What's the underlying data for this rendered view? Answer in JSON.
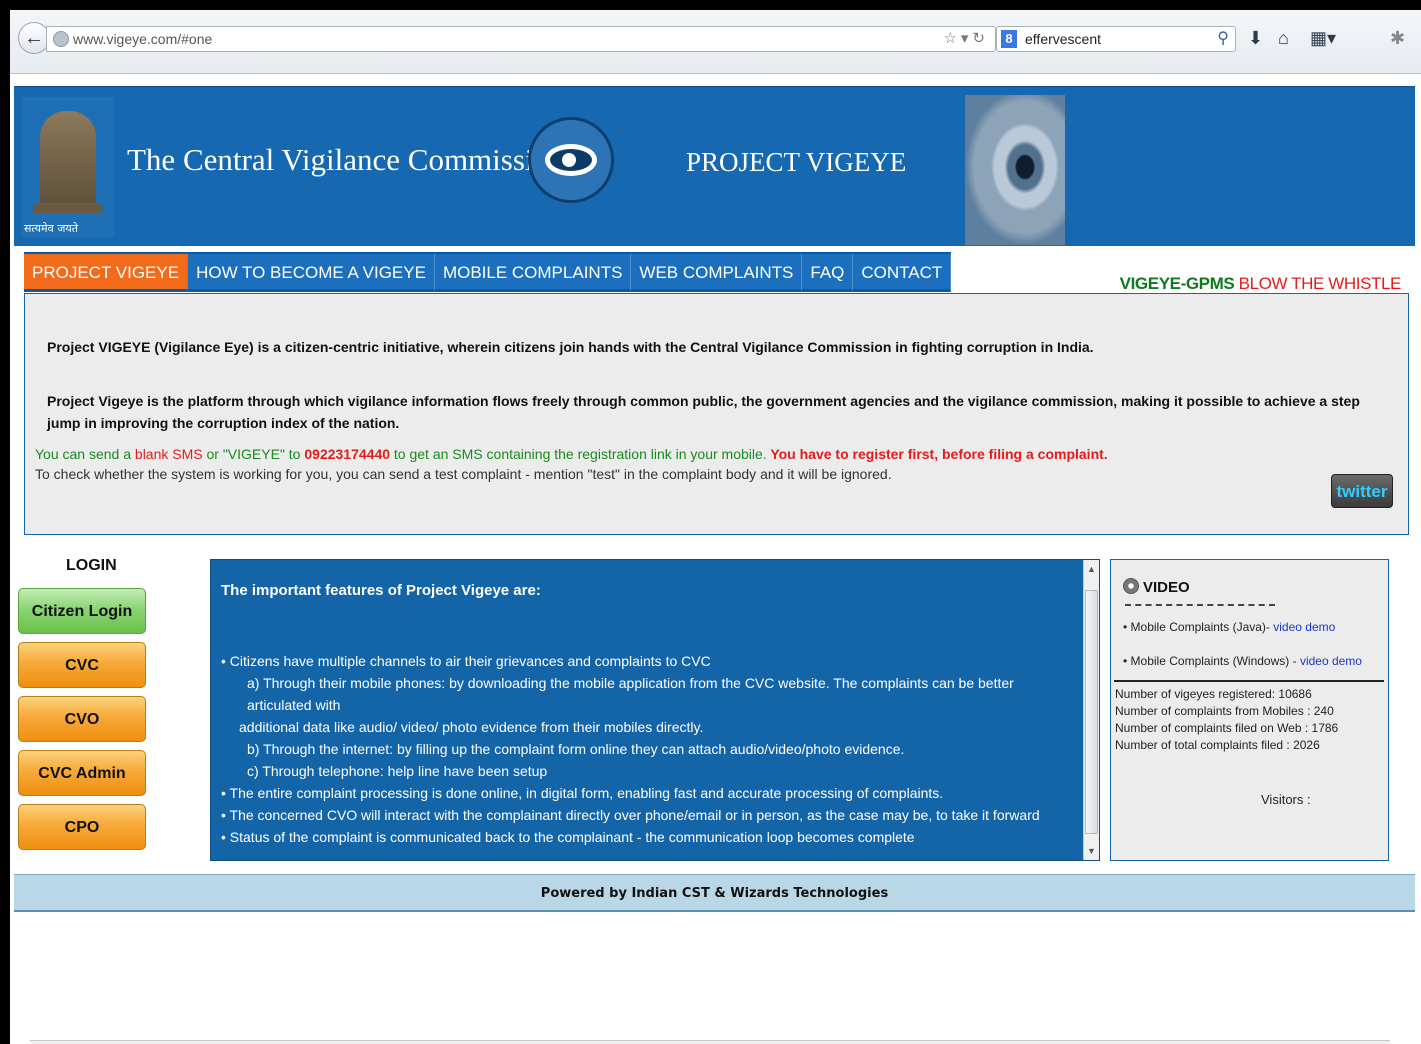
{
  "browser": {
    "url": "www.vigeye.com/#one",
    "search_value": "effervescent",
    "search_engine_icon": "8"
  },
  "header": {
    "emblem_caption": "सत्यमेव जयते",
    "title": "The Central Vigilance Commission",
    "project": "PROJECT VIGEYE"
  },
  "nav": {
    "tabs": [
      "PROJECT VIGEYE",
      "HOW TO BECOME A VIGEYE",
      "MOBILE COMPLAINTS",
      "WEB COMPLAINTS",
      "FAQ",
      "CONTACT"
    ],
    "gpms": "VIGEYE-GPMS",
    "whistle": "BLOW THE WHISTLE"
  },
  "intro": {
    "p1": "Project VIGEYE (Vigilance Eye) is a citizen-centric initiative, wherein citizens join hands with the Central Vigilance Commission in fighting corruption in India.",
    "p2": "Project Vigeye is the platform through which vigilance information flows freely through common public, the government agencies and the vigilance commission, making it possible to achieve a step jump in improving the corruption index of the nation.",
    "sms_1": "You can send a ",
    "sms_blank": "blank SMS",
    "sms_2": " or \"VIGEYE\" to ",
    "sms_number": "09223174440",
    "sms_3": " to get an SMS containing the registration link in your mobile.",
    "sms_register": " You have to register first, before filing a complaint.",
    "test_line": "To check whether the system is working for you, you can send a test complaint - mention \"test\" in the complaint body and it will be ignored.",
    "twitter": "twitter"
  },
  "login": {
    "title": "LOGIN",
    "buttons": [
      "Citizen Login",
      "CVC",
      "CVO",
      "CVC Admin",
      "CPO"
    ]
  },
  "features": {
    "title": "The important features of Project Vigeye are:",
    "lines": [
      "Citizens have multiple channels to air their grievances and complaints to CVC",
      "a) Through their mobile phones: by downloading the mobile application from the CVC website. The complaints can be better articulated          with",
      "additional data like audio/ video/ photo evidence from their mobiles directly.",
      "b) Through the internet: by filling up the complaint form online they can attach audio/video/photo evidence.",
      "c) Through telephone: help line have been setup",
      "The entire complaint processing is done online, in digital form, enabling fast and accurate processing of complaints.",
      "The concerned CVO will interact with the complainant directly over phone/email or in person, as the case may be, to take it forward",
      "Status of the complaint is communicated back to the complainant - the communication loop becomes complete"
    ]
  },
  "video": {
    "title": "VIDEO",
    "item1": "Mobile Complaints (Java)- ",
    "item2": "Mobile Complaints (Windows) - ",
    "link": "video demo",
    "stats": [
      "Number of vigeyes registered: 10686",
      "Number of complaints from Mobiles : 240",
      "Number of complaints filed on Web : 1786",
      "Number of total complaints filed : 2026"
    ],
    "visitors": "Visitors :"
  },
  "footer": {
    "text": "Powered by Indian CST & Wizards Technologies"
  }
}
